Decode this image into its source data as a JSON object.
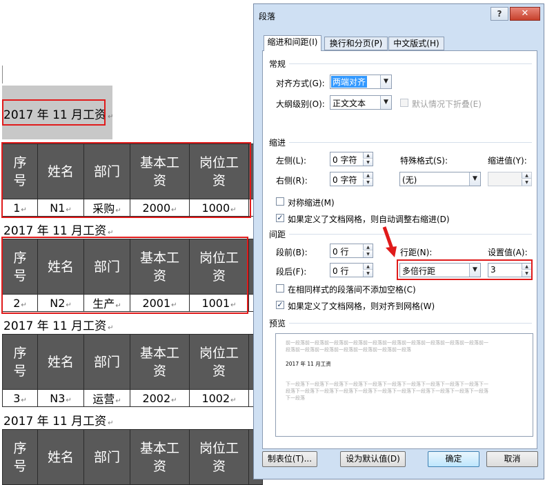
{
  "document": {
    "blocks": [
      {
        "title": "2017 年 11 月工资",
        "header": [
          "序号",
          "姓名",
          "部门",
          "基本工资",
          "岗位工资"
        ],
        "row": [
          "1",
          "N1",
          "采购",
          "2000",
          "1000"
        ]
      },
      {
        "title": "2017 年 11 月工资",
        "header": [
          "序号",
          "姓名",
          "部门",
          "基本工资",
          "岗位工资"
        ],
        "row": [
          "2",
          "N2",
          "生产",
          "2001",
          "1001"
        ]
      },
      {
        "title": "2017 年 11 月工资",
        "header": [
          "序号",
          "姓名",
          "部门",
          "基本工资",
          "岗位工资"
        ],
        "row": [
          "3",
          "N3",
          "运营",
          "2002",
          "1002"
        ]
      },
      {
        "title": "2017 年 11 月工资",
        "header": [
          "序号",
          "姓名",
          "部门",
          "基本工资",
          "岗位工资"
        ]
      }
    ],
    "header_lines": [
      [
        "序",
        "号"
      ],
      [
        "姓名"
      ],
      [
        "部门"
      ],
      [
        "基本工",
        "资"
      ],
      [
        "岗位工",
        "资"
      ]
    ],
    "paragraph_mark": "↵"
  },
  "dialog": {
    "title": "段落",
    "help_label": "?",
    "close_label": "✕",
    "tabs": [
      "缩进和间距(I)",
      "换行和分页(P)",
      "中文版式(H)"
    ],
    "general": {
      "section": "常规",
      "alignment_label": "对齐方式(G):",
      "alignment_value": "两端对齐",
      "outline_label": "大纲级别(O):",
      "outline_value": "正文文本",
      "collapse_label": "默认情况下折叠(E)",
      "collapse_checked": false
    },
    "indent": {
      "section": "缩进",
      "left_label": "左侧(L):",
      "left_value": "0 字符",
      "right_label": "右侧(R):",
      "right_value": "0 字符",
      "special_label": "特殊格式(S):",
      "special_value": "(无)",
      "indent_by_label": "缩进值(Y):",
      "indent_by_value": "",
      "mirror_label": "对称缩进(M)",
      "mirror_checked": false,
      "auto_adjust_label": "如果定义了文档网格，则自动调整右缩进(D)",
      "auto_adjust_checked": true
    },
    "spacing": {
      "section": "间距",
      "before_label": "段前(B):",
      "before_value": "0 行",
      "after_label": "段后(F):",
      "after_value": "0 行",
      "line_spacing_label": "行距(N):",
      "line_spacing_value": "多倍行距",
      "at_label": "设置值(A):",
      "at_value": "3",
      "no_space_label": "在相同样式的段落间不添加空格(C)",
      "no_space_checked": false,
      "snap_grid_label": "如果定义了文档网格，则对齐到网格(W)",
      "snap_grid_checked": true
    },
    "preview": {
      "section": "预览",
      "prev_text": "前一段落前一段落前一段落前一段落前一段落前一段落前一段落前一段落前一段落前一段落前一段落前一段落前一段落前一段落前一段落前一段落前一段落",
      "current_text": "2017 年 11 月工资",
      "next_text": "下一段落下一段落下一段落下一段落下一段落下一段落下一段落下一段落下一段落下一段落下一段落下一段落下一段落下一段落下一段落下一段落下一段落下一段落下一段落下一段落下一段落下一段落"
    },
    "buttons": {
      "tabs": "制表位(T)...",
      "set_default": "设为默认值(D)",
      "ok": "确定",
      "cancel": "取消"
    },
    "colors": {
      "annotation_red": "#e01a1a",
      "header_fill": "#595959",
      "dialog_bg": "#cfe0f3"
    }
  }
}
